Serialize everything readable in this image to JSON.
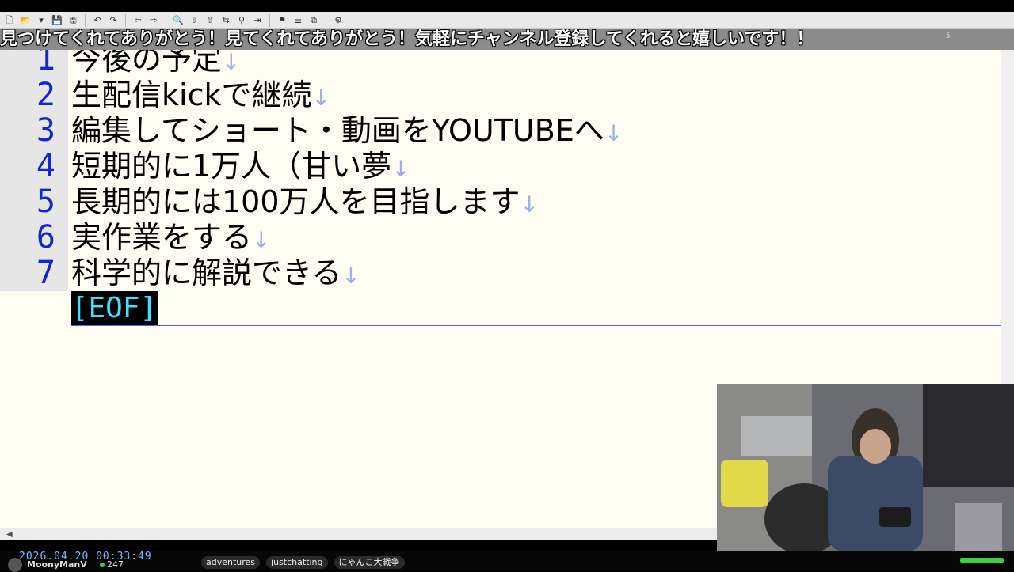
{
  "toolbar": {
    "icons": [
      "new-file-icon",
      "open-folder-icon",
      "dropdown-icon",
      "save-icon",
      "save-all-icon",
      "undo-icon",
      "redo-icon",
      "back-icon",
      "forward-icon",
      "find-icon",
      "find-next-icon",
      "find-prev-icon",
      "replace-icon",
      "grep-icon",
      "tag-jump-icon",
      "bookmark-icon",
      "outline-icon",
      "compare-icon",
      "settings-icon"
    ],
    "glyphs": [
      "🗋",
      "📂",
      "▾",
      "💾",
      "🖫",
      "↶",
      "↷",
      "⇦",
      "⇨",
      "🔍",
      "⇩",
      "⇧",
      "⇆",
      "⚲",
      "⇥",
      "⚑",
      "☰",
      "⧉",
      "⚙"
    ]
  },
  "ticker": {
    "text": "見つけてくれてありがとう！見てくれてありがとう！気軽にチャンネル登録してくれると嬉しいです！！",
    "ruler_mark": "5"
  },
  "editor": {
    "lines": [
      {
        "num": "1",
        "text": "今後の予定"
      },
      {
        "num": "2",
        "text": "生配信kickで継続"
      },
      {
        "num": "3",
        "text": "編集してショート・動画をYOUTUBEへ"
      },
      {
        "num": "4",
        "text": "短期的に1万人（甘い夢"
      },
      {
        "num": "5",
        "text": "長期的には100万人を目指します"
      },
      {
        "num": "6",
        "text": "実作業をする"
      },
      {
        "num": "7",
        "text": "科学的に解説できる"
      }
    ],
    "eol_mark": "↓",
    "eof_marker": "[EOF]",
    "hscroll_arrow": "◀"
  },
  "status": {
    "datetime": "2026.04.20 00:33:49",
    "channel": "MoonyManV",
    "viewers": "247",
    "tags": [
      "adventures",
      "justchatting",
      "にゃんこ大戦争"
    ]
  },
  "colors": {
    "line_number": "#1428c8",
    "eof_text": "#3de0ff",
    "editor_bg": "#fffdf2",
    "live": "#3ad13a"
  }
}
